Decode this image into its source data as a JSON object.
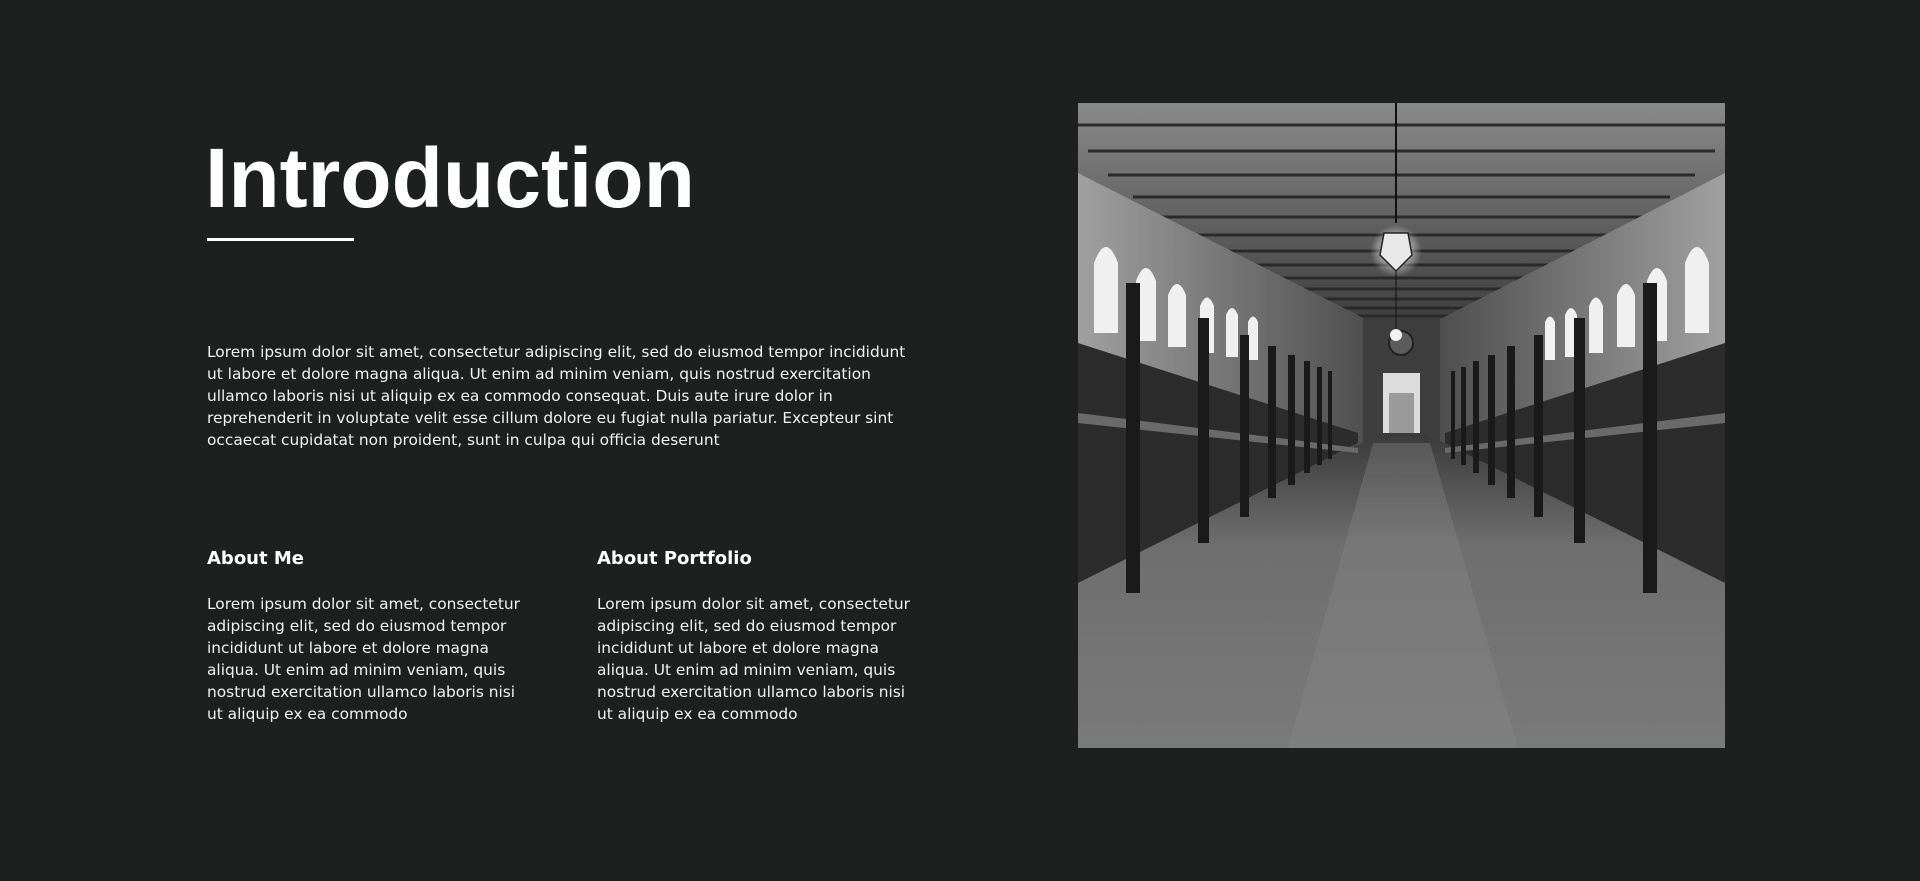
{
  "header": {
    "title": "Introduction"
  },
  "intro": {
    "text": "Lorem ipsum dolor sit amet, consectetur adipiscing elit, sed do eiusmod tempor incididunt ut labore et dolore magna aliqua. Ut enim ad minim veniam, quis nostrud exercitation ullamco laboris nisi ut aliquip ex ea commodo consequat. Duis aute irure dolor in reprehenderit in voluptate velit esse cillum dolore eu fugiat nulla pariatur. Excepteur sint occaecat cupidatat non proident, sunt in culpa qui officia deserunt"
  },
  "sections": [
    {
      "heading": "About Me",
      "text": "Lorem ipsum dolor sit amet, consectetur adipiscing elit, sed do eiusmod tempor incididunt ut labore et dolore magna aliqua. Ut enim ad minim veniam, quis nostrud exercitation ullamco laboris nisi ut aliquip ex ea commodo"
    },
    {
      "heading": "About Portfolio",
      "text": "Lorem ipsum dolor sit amet, consectetur adipiscing elit, sed do eiusmod tempor incididunt ut labore et dolore magna aliqua. Ut enim ad minim veniam, quis nostrud exercitation ullamco laboris nisi ut aliquip ex ea commodo"
    }
  ],
  "colors": {
    "background": "#1e1f1f",
    "text": "#ffffff"
  }
}
